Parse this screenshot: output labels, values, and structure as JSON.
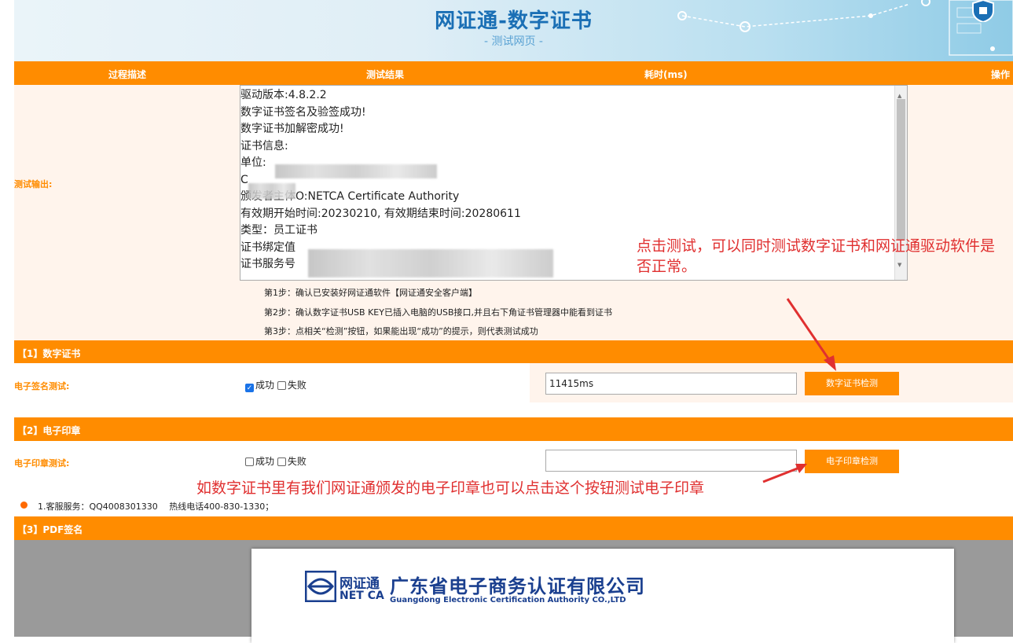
{
  "banner": {
    "title": "网证通-数字证书",
    "subtitle": "- 测试网页 -"
  },
  "header": {
    "col1": "过程描述",
    "col2": "测试结果",
    "col3": "耗时(ms)",
    "col4": "操作"
  },
  "output": {
    "label": "测试输出:",
    "lines": [
      "驱动版本:4.8.2.2",
      "数字证书签名及验签成功!",
      "数字证书加解密成功!",
      "",
      "证书信息:",
      "单位:",
      "C",
      "颁发者主体O:NETCA Certificate Authority",
      "有效期开始时间:20230210, 有效期结束时间:20280611",
      "类型：员工证书",
      "证书绑定值",
      "证书服务号"
    ]
  },
  "steps": [
    "第1步：确认已安装好网证通软件【网证通安全客户端】",
    "第2步：确认数字证书USB KEY已插入电脑的USB接口,并且右下角证书管理器中能看到证书",
    "第3步：点相关“检测”按钮，如果能出现“成功”的提示，则代表测试成功"
  ],
  "section1": {
    "title": "【1】数字证书",
    "label": "电子签名测试:",
    "success_label": "成功",
    "fail_label": "失败",
    "success_checked": true,
    "time_value": "11415ms",
    "button": "数字证书检测"
  },
  "section2": {
    "title": "【2】电子印章",
    "label": "电子印章测试:",
    "success_label": "成功",
    "fail_label": "失败",
    "time_value": "",
    "button": "电子印章检测"
  },
  "service_line": "1.客服服务：QQ4008301330　 热线电话400-830-1330；",
  "section3": {
    "title": "【3】PDF签名"
  },
  "pdf": {
    "logo_cn": "网证通",
    "logo_en": "NET CA",
    "company_cn": "广东省电子商务认证有限公司",
    "company_en": "Guangdong Electronic Certification Authority CO.,LTD"
  },
  "annotations": {
    "top": "点击测试，可以同时测试数字证书和网证通驱动软件是否正常。",
    "bottom": "如数字证书里有我们网证通颁发的电子印章也可以点击这个按钮测试电子印章"
  },
  "colors": {
    "accent": "#ff8c00",
    "pale": "#fff4ec",
    "annotation": "#e03030",
    "brand_blue": "#1a6fb5"
  }
}
